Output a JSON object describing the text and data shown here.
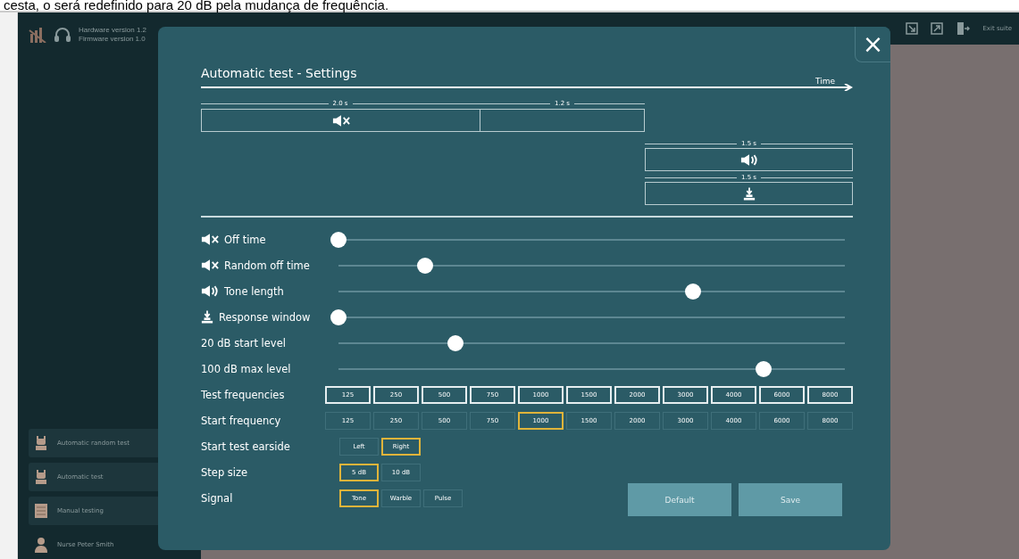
{
  "top_text": "cesta, o será redefinido para 20 dB pela mudança de frequência.",
  "header": {
    "hardware": "Hardware version 1.2",
    "firmware": "Firmware version 1.0",
    "exit": "Exit suite"
  },
  "sidebar": {
    "items": [
      {
        "label": "Automatic random test",
        "kind": "robot"
      },
      {
        "label": "Automatic test",
        "kind": "robot"
      },
      {
        "label": "Manual testing",
        "kind": "sheet"
      },
      {
        "label": "Nurse Peter Smith",
        "kind": "person"
      }
    ]
  },
  "dialog": {
    "title": "Automatic test - Settings",
    "close": "×",
    "timeline": {
      "axis": "Time",
      "off": "2.0 s",
      "random": "1.2 s",
      "tone": "1.5 s",
      "response": "1.5 s"
    },
    "sliders": [
      {
        "label": "Off time",
        "kind": "mute",
        "level": 0
      },
      {
        "label": "Random off time",
        "kind": "mute",
        "level": 0.17
      },
      {
        "label": "Tone length",
        "kind": "sound",
        "level": 0.7
      },
      {
        "label": "Response window",
        "kind": "response",
        "level": 0
      },
      {
        "label": "20 dB start level",
        "kind": "plain",
        "level": 0.23
      },
      {
        "label": "100 dB max level",
        "kind": "plain",
        "level": 0.84
      }
    ],
    "options": [
      {
        "label": "Test frequencies",
        "kind": "multi",
        "items": [
          {
            "label": "125",
            "selected": true
          },
          {
            "label": "250",
            "selected": true
          },
          {
            "label": "500",
            "selected": true
          },
          {
            "label": "750",
            "selected": true
          },
          {
            "label": "1000",
            "selected": true
          },
          {
            "label": "1500",
            "selected": true
          },
          {
            "label": "2000",
            "selected": true
          },
          {
            "label": "3000",
            "selected": true
          },
          {
            "label": "4000",
            "selected": true
          },
          {
            "label": "6000",
            "selected": true
          },
          {
            "label": "8000",
            "selected": true
          }
        ]
      },
      {
        "label": "Start frequency",
        "kind": "single",
        "items": [
          {
            "label": "125",
            "selected": false
          },
          {
            "label": "250",
            "selected": false
          },
          {
            "label": "500",
            "selected": false
          },
          {
            "label": "750",
            "selected": false
          },
          {
            "label": "1000",
            "selected": true
          },
          {
            "label": "1500",
            "selected": false
          },
          {
            "label": "2000",
            "selected": false
          },
          {
            "label": "3000",
            "selected": false
          },
          {
            "label": "4000",
            "selected": false
          },
          {
            "label": "6000",
            "selected": false
          },
          {
            "label": "8000",
            "selected": false
          }
        ]
      },
      {
        "label": "Start test earside",
        "kind": "single",
        "items": [
          {
            "label": "Left",
            "selected": false
          },
          {
            "label": "Right",
            "selected": true
          }
        ]
      },
      {
        "label": "Step size",
        "kind": "single",
        "items": [
          {
            "label": "5 dB",
            "selected": true
          },
          {
            "label": "10 dB",
            "selected": false
          }
        ]
      },
      {
        "label": "Signal",
        "kind": "single",
        "items": [
          {
            "label": "Tone",
            "selected": true
          },
          {
            "label": "Warble",
            "selected": false
          },
          {
            "label": "Pulse",
            "selected": false
          }
        ]
      }
    ],
    "buttons": [
      "Default",
      "Save"
    ]
  }
}
